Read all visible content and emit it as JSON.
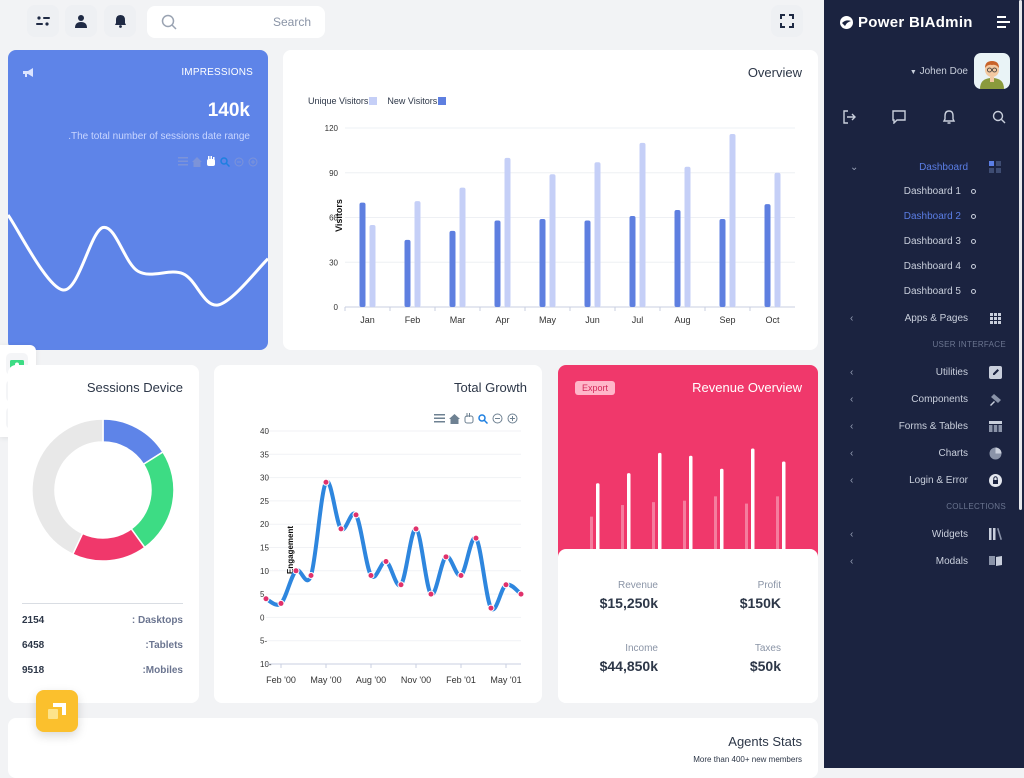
{
  "topbar": {
    "search_placeholder": "Search",
    "icons": [
      "settings-toggle-icon",
      "user-icon",
      "bell-icon",
      "search-icon",
      "fullscreen-icon"
    ]
  },
  "impressions": {
    "title": "IMPRESSIONS",
    "value": "140k",
    "subtitle": ".The total number of sessions date range",
    "color": "#5e84e8",
    "sparkline": [
      10,
      4,
      9,
      5.5,
      5.3,
      2.8,
      6.5
    ]
  },
  "overview": {
    "title": "Overview",
    "legend": [
      {
        "name": "Unique Visitors",
        "color": "#c5cff7"
      },
      {
        "name": "New Visitors",
        "color": "#5e7fe0"
      }
    ]
  },
  "sessions": {
    "title": "Sessions Device",
    "rows": [
      {
        "value": "2154",
        "label": ": Dasktops"
      },
      {
        "value": "6458",
        "label": ":Tablets"
      },
      {
        "value": "9518",
        "label": ":Mobiles"
      }
    ]
  },
  "growth": {
    "title": "Total Growth"
  },
  "revenue": {
    "title": "Revenue Overview",
    "export_label": "Export",
    "color": "#f0386b",
    "bars_high": [
      46,
      53,
      67,
      65,
      56,
      70,
      61
    ],
    "bars_low": [
      23,
      31,
      33,
      34,
      37,
      32,
      37
    ],
    "stats": [
      {
        "label": "Revenue",
        "value": "$15,250k"
      },
      {
        "label": "Profit",
        "value": "$150K"
      },
      {
        "label": "Income",
        "value": "$44,850k"
      },
      {
        "label": "Taxes",
        "value": "$50k"
      }
    ]
  },
  "agents": {
    "title": "Agents Stats",
    "subtitle": "More than 400+ new members"
  },
  "sidebar": {
    "brand": "Power BIAdmin",
    "user_name": "Johen Doe",
    "dashboard_label": "Dashboard",
    "sub_items": [
      "Dashboard 1",
      "Dashboard 2",
      "Dashboard 3",
      "Dashboard 4",
      "Dashboard 5"
    ],
    "active_sub": "Dashboard 2",
    "apps_label": "Apps & Pages",
    "section_ui": "USER INTERFACE",
    "ui_items": [
      "Utilities",
      "Components",
      "Forms & Tables",
      "Charts",
      "Login & Error"
    ],
    "section_collections": "COLLECTIONS",
    "collection_items": [
      "Widgets",
      "Modals"
    ]
  },
  "chart_data": [
    {
      "type": "bar",
      "title": "Overview",
      "categories": [
        "Jan",
        "Feb",
        "Mar",
        "Apr",
        "May",
        "Jun",
        "Jul",
        "Aug",
        "Sep",
        "Oct"
      ],
      "series": [
        {
          "name": "New Visitors",
          "values": [
            70,
            45,
            51,
            58,
            59,
            58,
            61,
            65,
            59,
            69
          ]
        },
        {
          "name": "Unique Visitors",
          "values": [
            55,
            71,
            80,
            100,
            89,
            97,
            110,
            94,
            116,
            90
          ]
        }
      ],
      "xlabel": "",
      "ylabel": "Visitors",
      "ylim": [
        0,
        120
      ],
      "yticks": [
        0,
        30,
        60,
        90,
        120
      ],
      "legend": "top-left"
    },
    {
      "type": "pie",
      "title": "Sessions Device",
      "categories": [
        "Blue segment",
        "Green segment",
        "Red segment",
        "Gray segment"
      ],
      "values": [
        16,
        24,
        17,
        43
      ],
      "colors": [
        "#5e84e8",
        "#3ddc84",
        "#f0386b",
        "#e8e8e8"
      ],
      "donut": true
    },
    {
      "type": "line",
      "title": "Total Growth",
      "x": [
        "Jan '00",
        "Feb '00",
        "Mar '00",
        "Apr '00",
        "May '00",
        "Jun '00",
        "Jul '00",
        "Aug '00",
        "Sep '00",
        "Oct '00",
        "Nov '00",
        "Dec '00",
        "Jan '01",
        "Feb '01",
        "Mar '01",
        "Apr '01",
        "May '01",
        "Jun '01"
      ],
      "series": [
        {
          "name": "Engagement",
          "values": [
            4,
            3,
            10,
            9,
            29,
            19,
            22,
            9,
            12,
            7,
            19,
            5,
            13,
            9,
            17,
            2,
            7,
            5
          ]
        }
      ],
      "xticks": [
        "Feb '00",
        "May '00",
        "Aug '00",
        "Nov '00",
        "Feb '01",
        "May '01"
      ],
      "yticks": [
        "40",
        "35",
        "30",
        "25",
        "20",
        "15",
        "10",
        "5",
        "0",
        "5-",
        "10-"
      ],
      "ylabel": "Engagement",
      "ylim": [
        -10,
        40
      ]
    }
  ]
}
